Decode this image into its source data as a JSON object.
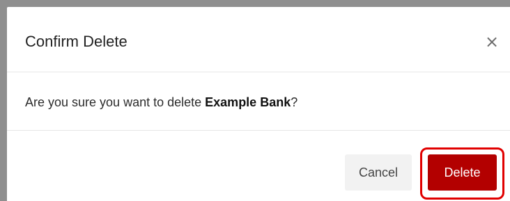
{
  "dialog": {
    "title": "Confirm Delete",
    "close_glyph": "×",
    "close_icon": "close-icon",
    "message_prefix": "Are you sure you want to delete ",
    "message_subject": "Example Bank",
    "message_suffix": "?",
    "cancel_label": "Cancel",
    "delete_label": "Delete"
  },
  "colors": {
    "danger": "#b30000",
    "highlight": "#e10000",
    "cancel_bg": "#f2f2f2"
  }
}
